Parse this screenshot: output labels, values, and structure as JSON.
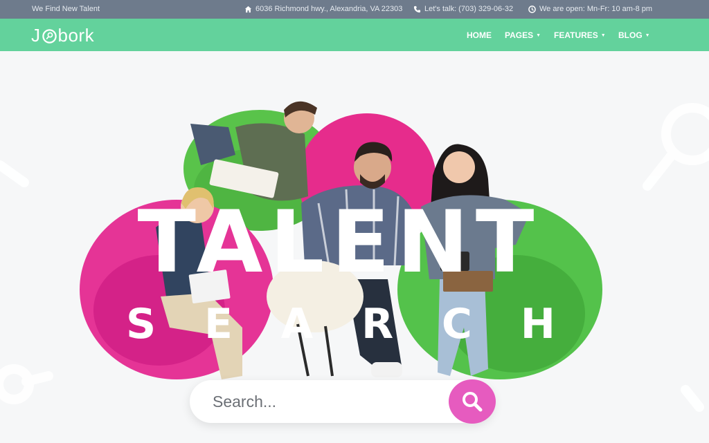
{
  "topbar": {
    "tagline": "We Find New Talent",
    "address": "6036 Richmond hwy., Alexandria, VA 22303",
    "phone": "Let's talk: (703) 329-06-32",
    "hours": "We are open:  Mn-Fr: 10 am-8 pm",
    "icons": [
      "home-icon",
      "phone-icon",
      "clock-icon"
    ]
  },
  "brand": {
    "logo_left": "J",
    "logo_right": "bork",
    "accent": "#63d29c",
    "search_accent": "#e65bbf"
  },
  "nav": {
    "home": "HOME",
    "pages": "PAGES",
    "features": "FEATURES",
    "blog": "BLOG"
  },
  "hero": {
    "title_line1": "TALENT",
    "title_line2": [
      "S",
      "E",
      "A",
      "R",
      "C",
      "H"
    ]
  },
  "search": {
    "placeholder": "Search...",
    "button_icon": "search-icon"
  }
}
